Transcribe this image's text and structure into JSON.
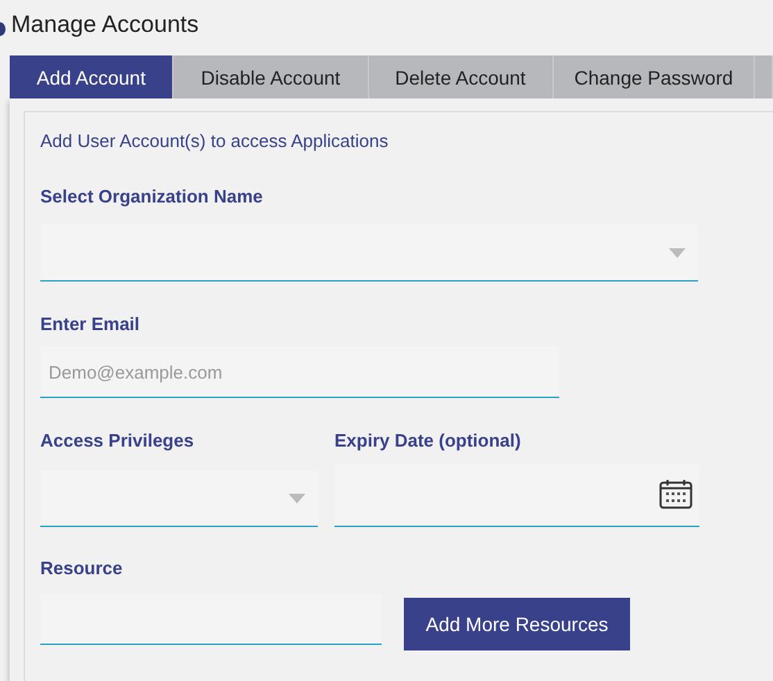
{
  "page": {
    "title": "Manage Accounts"
  },
  "tabs": [
    {
      "label": "Add Account",
      "selected": true
    },
    {
      "label": "Disable Account",
      "selected": false
    },
    {
      "label": "Delete Account",
      "selected": false
    },
    {
      "label": "Change Password",
      "selected": false
    }
  ],
  "form": {
    "heading": "Add User Account(s) to access Applications",
    "organization": {
      "label": "Select Organization Name"
    },
    "email": {
      "label": "Enter Email",
      "placeholder": "Demo@example.com"
    },
    "access": {
      "label": "Access Privileges"
    },
    "expiry": {
      "label": "Expiry Date (optional)"
    },
    "resource": {
      "label": "Resource"
    },
    "add_button": "Add More Resources"
  }
}
